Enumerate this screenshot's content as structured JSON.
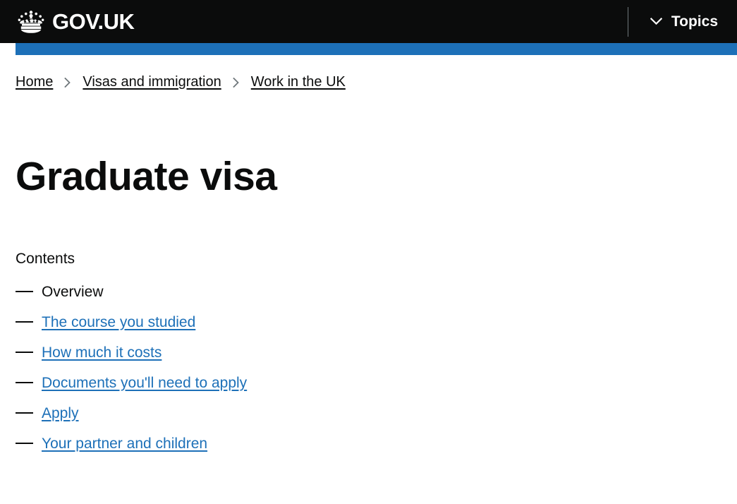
{
  "header": {
    "logo_icon": "crown-icon",
    "logo_text": "GOV.UK",
    "topics_label": "Topics",
    "topics_icon": "chevron-down-icon",
    "background_color": "#0b0c0c"
  },
  "accent_bar": {
    "color": "#1d70b8"
  },
  "breadcrumbs": [
    {
      "label": "Home"
    },
    {
      "label": "Visas and immigration"
    },
    {
      "label": "Work in the UK"
    }
  ],
  "breadcrumb_separator_icon": "chevron-right-icon",
  "main": {
    "title": "Graduate visa",
    "contents_heading": "Contents",
    "contents": [
      {
        "label": "Overview",
        "is_link": false
      },
      {
        "label": "The course you studied",
        "is_link": true
      },
      {
        "label": "How much it costs",
        "is_link": true
      },
      {
        "label": "Documents you'll need to apply",
        "is_link": true
      },
      {
        "label": "Apply",
        "is_link": true
      },
      {
        "label": "Your partner and children",
        "is_link": true
      }
    ]
  },
  "colors": {
    "link": "#1d70b8",
    "text": "#0b0c0c",
    "breadcrumb_separator": "#6f777b"
  }
}
